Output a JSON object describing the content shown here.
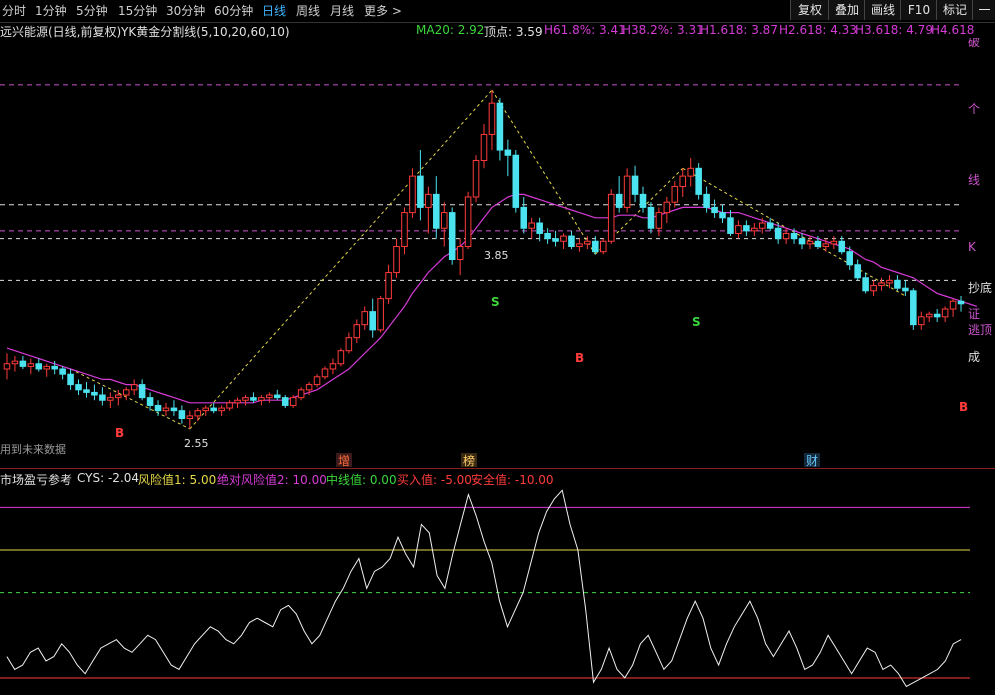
{
  "toolbar": {
    "periods": [
      "分时",
      "1分钟",
      "5分钟",
      "15分钟",
      "30分钟",
      "60分钟",
      "日线",
      "周线",
      "月线",
      "更多 >"
    ],
    "active_period": "日线",
    "right_buttons": [
      "复权",
      "叠加",
      "画线",
      "F10",
      "标记",
      "一自"
    ]
  },
  "info_bar": {
    "stock_title": "远兴能源(日线,前复权)",
    "indicator_title": "YK黄金分割线(5,10,20,60,10)",
    "ma20": "MA20: 2.92",
    "top_point": "顶点: 3.59",
    "h618": "H61.8%: 3.41",
    "h382": "H38.2%: 3.31",
    "h1618": "H1.618: 3.87",
    "h2618": "H2.618: 4.33",
    "h3618": "H3.618: 4.79",
    "h4618": "H4.618"
  },
  "price_panel": {
    "right_labels": [
      "破",
      "个",
      "线",
      "K",
      "抄底",
      "证",
      "逃顶",
      "成"
    ],
    "high_label": "3.85",
    "low_label": "2.55",
    "signals": [
      "B",
      "S",
      "B",
      "S",
      "B"
    ],
    "future_data_text": "用到未来数据",
    "event_markers": [
      "增",
      "榜",
      "财"
    ]
  },
  "cys_panel": {
    "title": "市场盈亏参考",
    "cys": "CYS: -2.04",
    "risk1": "风险值1: 5.00",
    "risk2": "绝对风险值2: 10.00",
    "midline": "中线值: 0.00",
    "buy": "买入值: -5.00",
    "safe": "安全值: -10.00"
  },
  "colors": {
    "up": "#ff3b3b",
    "down": "#4be3ef",
    "ma": "#d63bd6",
    "golden_line": "#cc55cc",
    "dashed_white": "#dddddd",
    "yellow_dash": "#e6d84a",
    "accent": "#3db4ff"
  },
  "chart_data": [
    {
      "type": "candlestick",
      "title": "远兴能源(日线,前复权)",
      "ohlc": [
        [
          2.78,
          2.84,
          2.74,
          2.8
        ],
        [
          2.8,
          2.83,
          2.77,
          2.81
        ],
        [
          2.81,
          2.83,
          2.78,
          2.79
        ],
        [
          2.79,
          2.82,
          2.76,
          2.8
        ],
        [
          2.8,
          2.82,
          2.77,
          2.78
        ],
        [
          2.78,
          2.8,
          2.75,
          2.79
        ],
        [
          2.79,
          2.81,
          2.76,
          2.78
        ],
        [
          2.78,
          2.79,
          2.74,
          2.76
        ],
        [
          2.76,
          2.78,
          2.7,
          2.72
        ],
        [
          2.72,
          2.74,
          2.68,
          2.7
        ],
        [
          2.7,
          2.73,
          2.67,
          2.69
        ],
        [
          2.69,
          2.72,
          2.66,
          2.68
        ],
        [
          2.68,
          2.71,
          2.64,
          2.66
        ],
        [
          2.66,
          2.69,
          2.63,
          2.67
        ],
        [
          2.67,
          2.7,
          2.64,
          2.68
        ],
        [
          2.68,
          2.71,
          2.66,
          2.7
        ],
        [
          2.7,
          2.74,
          2.68,
          2.72
        ],
        [
          2.72,
          2.74,
          2.66,
          2.67
        ],
        [
          2.67,
          2.69,
          2.62,
          2.64
        ],
        [
          2.64,
          2.66,
          2.6,
          2.62
        ],
        [
          2.62,
          2.65,
          2.6,
          2.63
        ],
        [
          2.63,
          2.66,
          2.6,
          2.62
        ],
        [
          2.62,
          2.64,
          2.57,
          2.59
        ],
        [
          2.59,
          2.62,
          2.55,
          2.6
        ],
        [
          2.6,
          2.63,
          2.58,
          2.62
        ],
        [
          2.62,
          2.64,
          2.6,
          2.63
        ],
        [
          2.63,
          2.65,
          2.61,
          2.62
        ],
        [
          2.62,
          2.64,
          2.6,
          2.63
        ],
        [
          2.63,
          2.66,
          2.62,
          2.65
        ],
        [
          2.65,
          2.67,
          2.63,
          2.66
        ],
        [
          2.66,
          2.68,
          2.64,
          2.67
        ],
        [
          2.67,
          2.69,
          2.65,
          2.66
        ],
        [
          2.66,
          2.68,
          2.64,
          2.67
        ],
        [
          2.67,
          2.69,
          2.65,
          2.68
        ],
        [
          2.68,
          2.7,
          2.66,
          2.67
        ],
        [
          2.67,
          2.68,
          2.63,
          2.64
        ],
        [
          2.64,
          2.68,
          2.63,
          2.67
        ],
        [
          2.67,
          2.71,
          2.66,
          2.7
        ],
        [
          2.7,
          2.73,
          2.68,
          2.72
        ],
        [
          2.72,
          2.76,
          2.71,
          2.75
        ],
        [
          2.75,
          2.79,
          2.74,
          2.78
        ],
        [
          2.78,
          2.82,
          2.76,
          2.8
        ],
        [
          2.8,
          2.86,
          2.79,
          2.85
        ],
        [
          2.85,
          2.92,
          2.84,
          2.9
        ],
        [
          2.9,
          2.97,
          2.88,
          2.95
        ],
        [
          2.95,
          3.02,
          2.93,
          3.0
        ],
        [
          3.0,
          3.05,
          2.9,
          2.93
        ],
        [
          2.93,
          3.06,
          2.92,
          3.05
        ],
        [
          3.05,
          3.18,
          3.03,
          3.15
        ],
        [
          3.15,
          3.28,
          3.13,
          3.25
        ],
        [
          3.25,
          3.4,
          3.22,
          3.38
        ],
        [
          3.38,
          3.55,
          3.36,
          3.52
        ],
        [
          3.52,
          3.62,
          3.35,
          3.4
        ],
        [
          3.4,
          3.48,
          3.3,
          3.45
        ],
        [
          3.45,
          3.52,
          3.28,
          3.32
        ],
        [
          3.32,
          3.42,
          3.25,
          3.38
        ],
        [
          3.38,
          3.4,
          3.18,
          3.2
        ],
        [
          3.2,
          3.28,
          3.14,
          3.25
        ],
        [
          3.25,
          3.46,
          3.24,
          3.44
        ],
        [
          3.44,
          3.6,
          3.42,
          3.58
        ],
        [
          3.58,
          3.72,
          3.55,
          3.68
        ],
        [
          3.68,
          3.85,
          3.62,
          3.8
        ],
        [
          3.8,
          3.82,
          3.58,
          3.62
        ],
        [
          3.62,
          3.66,
          3.52,
          3.6
        ],
        [
          3.6,
          3.62,
          3.38,
          3.4
        ],
        [
          3.4,
          3.44,
          3.3,
          3.32
        ],
        [
          3.32,
          3.36,
          3.28,
          3.34
        ],
        [
          3.34,
          3.36,
          3.27,
          3.3
        ],
        [
          3.3,
          3.32,
          3.26,
          3.28
        ],
        [
          3.28,
          3.31,
          3.25,
          3.27
        ],
        [
          3.27,
          3.3,
          3.24,
          3.29
        ],
        [
          3.29,
          3.31,
          3.24,
          3.25
        ],
        [
          3.25,
          3.28,
          3.23,
          3.26
        ],
        [
          3.26,
          3.29,
          3.24,
          3.27
        ],
        [
          3.27,
          3.29,
          3.22,
          3.23
        ],
        [
          3.23,
          3.28,
          3.22,
          3.27
        ],
        [
          3.27,
          3.47,
          3.26,
          3.45
        ],
        [
          3.45,
          3.52,
          3.38,
          3.4
        ],
        [
          3.4,
          3.55,
          3.38,
          3.52
        ],
        [
          3.52,
          3.56,
          3.42,
          3.45
        ],
        [
          3.45,
          3.48,
          3.38,
          3.4
        ],
        [
          3.4,
          3.42,
          3.3,
          3.32
        ],
        [
          3.32,
          3.4,
          3.29,
          3.38
        ],
        [
          3.38,
          3.44,
          3.34,
          3.42
        ],
        [
          3.42,
          3.5,
          3.4,
          3.48
        ],
        [
          3.48,
          3.55,
          3.44,
          3.52
        ],
        [
          3.52,
          3.59,
          3.48,
          3.55
        ],
        [
          3.55,
          3.57,
          3.43,
          3.45
        ],
        [
          3.45,
          3.48,
          3.38,
          3.4
        ],
        [
          3.4,
          3.43,
          3.36,
          3.38
        ],
        [
          3.38,
          3.41,
          3.34,
          3.36
        ],
        [
          3.36,
          3.39,
          3.29,
          3.3
        ],
        [
          3.3,
          3.35,
          3.28,
          3.33
        ],
        [
          3.33,
          3.35,
          3.29,
          3.31
        ],
        [
          3.31,
          3.34,
          3.29,
          3.32
        ],
        [
          3.32,
          3.36,
          3.3,
          3.34
        ],
        [
          3.34,
          3.36,
          3.31,
          3.32
        ],
        [
          3.32,
          3.34,
          3.26,
          3.28
        ],
        [
          3.28,
          3.32,
          3.26,
          3.3
        ],
        [
          3.3,
          3.32,
          3.26,
          3.28
        ],
        [
          3.28,
          3.3,
          3.24,
          3.26
        ],
        [
          3.26,
          3.29,
          3.24,
          3.27
        ],
        [
          3.27,
          3.29,
          3.24,
          3.25
        ],
        [
          3.25,
          3.28,
          3.23,
          3.26
        ],
        [
          3.26,
          3.29,
          3.24,
          3.27
        ],
        [
          3.27,
          3.29,
          3.22,
          3.23
        ],
        [
          3.23,
          3.25,
          3.16,
          3.18
        ],
        [
          3.18,
          3.2,
          3.12,
          3.13
        ],
        [
          3.13,
          3.15,
          3.07,
          3.08
        ],
        [
          3.08,
          3.12,
          3.06,
          3.1
        ],
        [
          3.1,
          3.13,
          3.08,
          3.11
        ],
        [
          3.11,
          3.14,
          3.09,
          3.12
        ],
        [
          3.12,
          3.14,
          3.08,
          3.09
        ],
        [
          3.09,
          3.12,
          3.06,
          3.08
        ],
        [
          3.08,
          3.09,
          2.93,
          2.95
        ],
        [
          2.95,
          3.0,
          2.93,
          2.98
        ],
        [
          2.98,
          3.0,
          2.96,
          2.99
        ],
        [
          2.99,
          3.01,
          2.96,
          2.98
        ],
        [
          2.98,
          3.02,
          2.96,
          3.01
        ],
        [
          3.01,
          3.05,
          2.98,
          3.04
        ],
        [
          3.04,
          3.06,
          3.0,
          3.03
        ]
      ],
      "ma20": [
        2.86,
        2.85,
        2.84,
        2.83,
        2.82,
        2.81,
        2.8,
        2.79,
        2.78,
        2.77,
        2.76,
        2.75,
        2.74,
        2.74,
        2.73,
        2.72,
        2.72,
        2.71,
        2.7,
        2.69,
        2.68,
        2.67,
        2.66,
        2.65,
        2.65,
        2.65,
        2.65,
        2.65,
        2.65,
        2.65,
        2.65,
        2.65,
        2.66,
        2.66,
        2.66,
        2.66,
        2.67,
        2.68,
        2.69,
        2.7,
        2.72,
        2.74,
        2.76,
        2.78,
        2.81,
        2.84,
        2.87,
        2.9,
        2.94,
        2.98,
        3.02,
        3.07,
        3.11,
        3.15,
        3.18,
        3.21,
        3.23,
        3.25,
        3.28,
        3.32,
        3.36,
        3.4,
        3.42,
        3.44,
        3.45,
        3.45,
        3.44,
        3.43,
        3.42,
        3.41,
        3.4,
        3.39,
        3.38,
        3.37,
        3.36,
        3.36,
        3.36,
        3.37,
        3.37,
        3.37,
        3.36,
        3.36,
        3.37,
        3.38,
        3.39,
        3.4,
        3.4,
        3.4,
        3.4,
        3.39,
        3.38,
        3.38,
        3.38,
        3.37,
        3.36,
        3.35,
        3.34,
        3.33,
        3.32,
        3.31,
        3.3,
        3.29,
        3.28,
        3.27,
        3.26,
        3.25,
        3.24,
        3.22,
        3.2,
        3.19,
        3.17,
        3.16,
        3.15,
        3.14,
        3.13,
        3.11,
        3.09,
        3.07,
        3.06,
        3.05,
        3.04,
        3.03,
        3.02
      ],
      "ylim": [
        2.4,
        4.05
      ],
      "levels": [
        3.41,
        3.31,
        3.87,
        4.33,
        4.79
      ],
      "high_label": 3.85,
      "low_label": 2.55
    },
    {
      "type": "line",
      "title": "市场盈亏参考",
      "series": [
        {
          "name": "CYS",
          "values": [
            -7.5,
            -9.0,
            -8.5,
            -7.0,
            -6.5,
            -8.0,
            -7.5,
            -6.0,
            -7.0,
            -8.5,
            -9.5,
            -8.0,
            -6.5,
            -6.0,
            -5.5,
            -6.5,
            -7.0,
            -6.0,
            -5.0,
            -5.5,
            -7.0,
            -8.5,
            -9.0,
            -7.5,
            -6.0,
            -5.0,
            -4.0,
            -4.5,
            -5.5,
            -6.0,
            -5.0,
            -3.5,
            -3.0,
            -3.5,
            -4.0,
            -2.0,
            -1.5,
            -2.5,
            -4.5,
            -6.0,
            -5.0,
            -3.0,
            -1.0,
            0.5,
            2.5,
            4.0,
            0.5,
            2.5,
            3.0,
            4.0,
            6.5,
            4.5,
            3.0,
            8.0,
            7.0,
            2.0,
            0.5,
            4.5,
            8.0,
            11.5,
            9.0,
            6.0,
            3.5,
            -1.0,
            -4.0,
            -2.0,
            0.0,
            3.5,
            7.0,
            9.5,
            11.0,
            12.0,
            8.0,
            5.0,
            -2.0,
            -10.5,
            -9.0,
            -6.5,
            -9.0,
            -10.0,
            -8.5,
            -6.0,
            -5.0,
            -7.0,
            -9.0,
            -8.0,
            -5.5,
            -3.0,
            -1.0,
            -3.0,
            -6.5,
            -8.5,
            -6.0,
            -4.0,
            -2.5,
            -1.0,
            -3.0,
            -6.0,
            -7.5,
            -6.0,
            -4.5,
            -6.5,
            -9.0,
            -8.5,
            -7.0,
            -5.0,
            -6.5,
            -8.0,
            -9.5,
            -8.0,
            -6.5,
            -7.0,
            -9.0,
            -8.5,
            -9.5,
            -11.0,
            -10.5,
            -10.0,
            -9.5,
            -9.0,
            -8.0,
            -6.0,
            -5.5
          ]
        }
      ],
      "reference_lines": [
        10.0,
        5.0,
        0.0,
        -5.0,
        -10.0
      ],
      "ylim": [
        -12.0,
        12.5
      ]
    }
  ]
}
